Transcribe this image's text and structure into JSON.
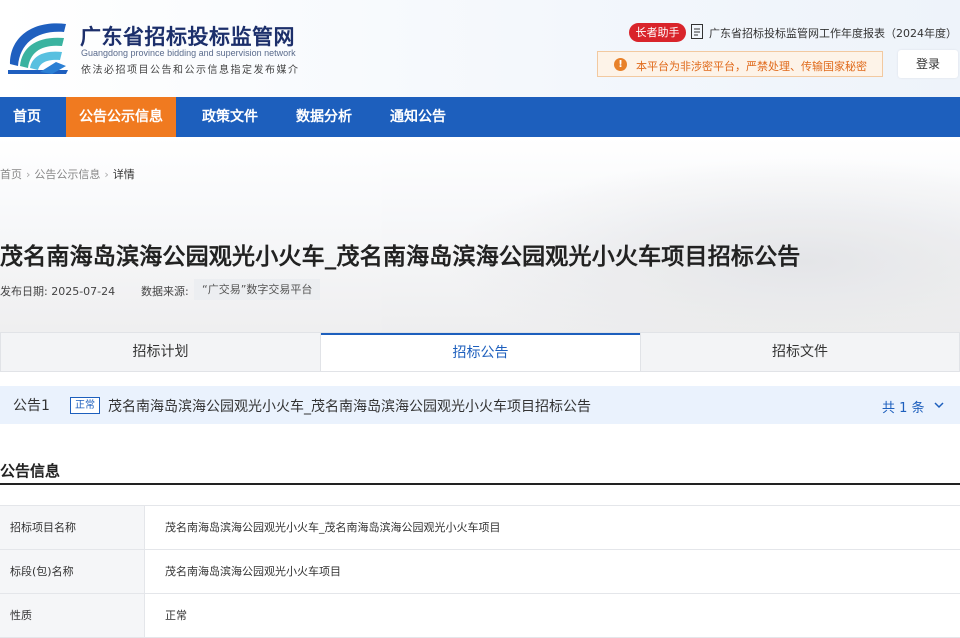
{
  "header": {
    "site_title": "广东省招标投标监管网",
    "site_title_en": "Guangdong province bidding and supervision network",
    "site_subtitle": "依法必招项目公告和公示信息指定发布媒介",
    "elder_assistant": "长者助手",
    "report_link": "广东省招标投标监管网工作年度报表（2024年度）",
    "warning_text": "本平台为非涉密平台，严禁处理、传输国家秘密",
    "login": "登录"
  },
  "nav": {
    "items": [
      {
        "label": "首页"
      },
      {
        "label": "公告公示信息"
      },
      {
        "label": "政策文件"
      },
      {
        "label": "数据分析"
      },
      {
        "label": "通知公告"
      }
    ],
    "active_index": 1
  },
  "breadcrumb": {
    "items": [
      "首页",
      "公告公示信息",
      "详情"
    ]
  },
  "page": {
    "title": "茂名南海岛滨海公园观光小火车_茂名南海岛滨海公园观光小火车项目招标公告",
    "publish_date_label": "发布日期:",
    "publish_date": "2025-07-24",
    "source_label": "数据来源:",
    "source": "“广交易”数字交易平台"
  },
  "tabs": {
    "items": [
      {
        "label": "招标计划"
      },
      {
        "label": "招标公告"
      },
      {
        "label": "招标文件"
      }
    ],
    "active_index": 1
  },
  "notice": {
    "index_label": "公告1",
    "status_badge": "正常",
    "title": "茂名南海岛滨海公园观光小火车_茂名南海岛滨海公园观光小火车项目招标公告",
    "count_label": "共 1 条"
  },
  "section": {
    "title": "公告信息",
    "rows": [
      {
        "label": "招标项目名称",
        "value": "茂名南海岛滨海公园观光小火车_茂名南海岛滨海公园观光小火车项目"
      },
      {
        "label": "标段(包)名称",
        "value": "茂名南海岛滨海公园观光小火车项目"
      },
      {
        "label": "性质",
        "value": "正常"
      }
    ]
  },
  "colors": {
    "nav_bg": "#1d5fbd",
    "nav_active": "#f07a20",
    "elder_btn": "#d9242b",
    "warning_text": "#e06a1b",
    "notice_bg": "#eaf2fd"
  }
}
